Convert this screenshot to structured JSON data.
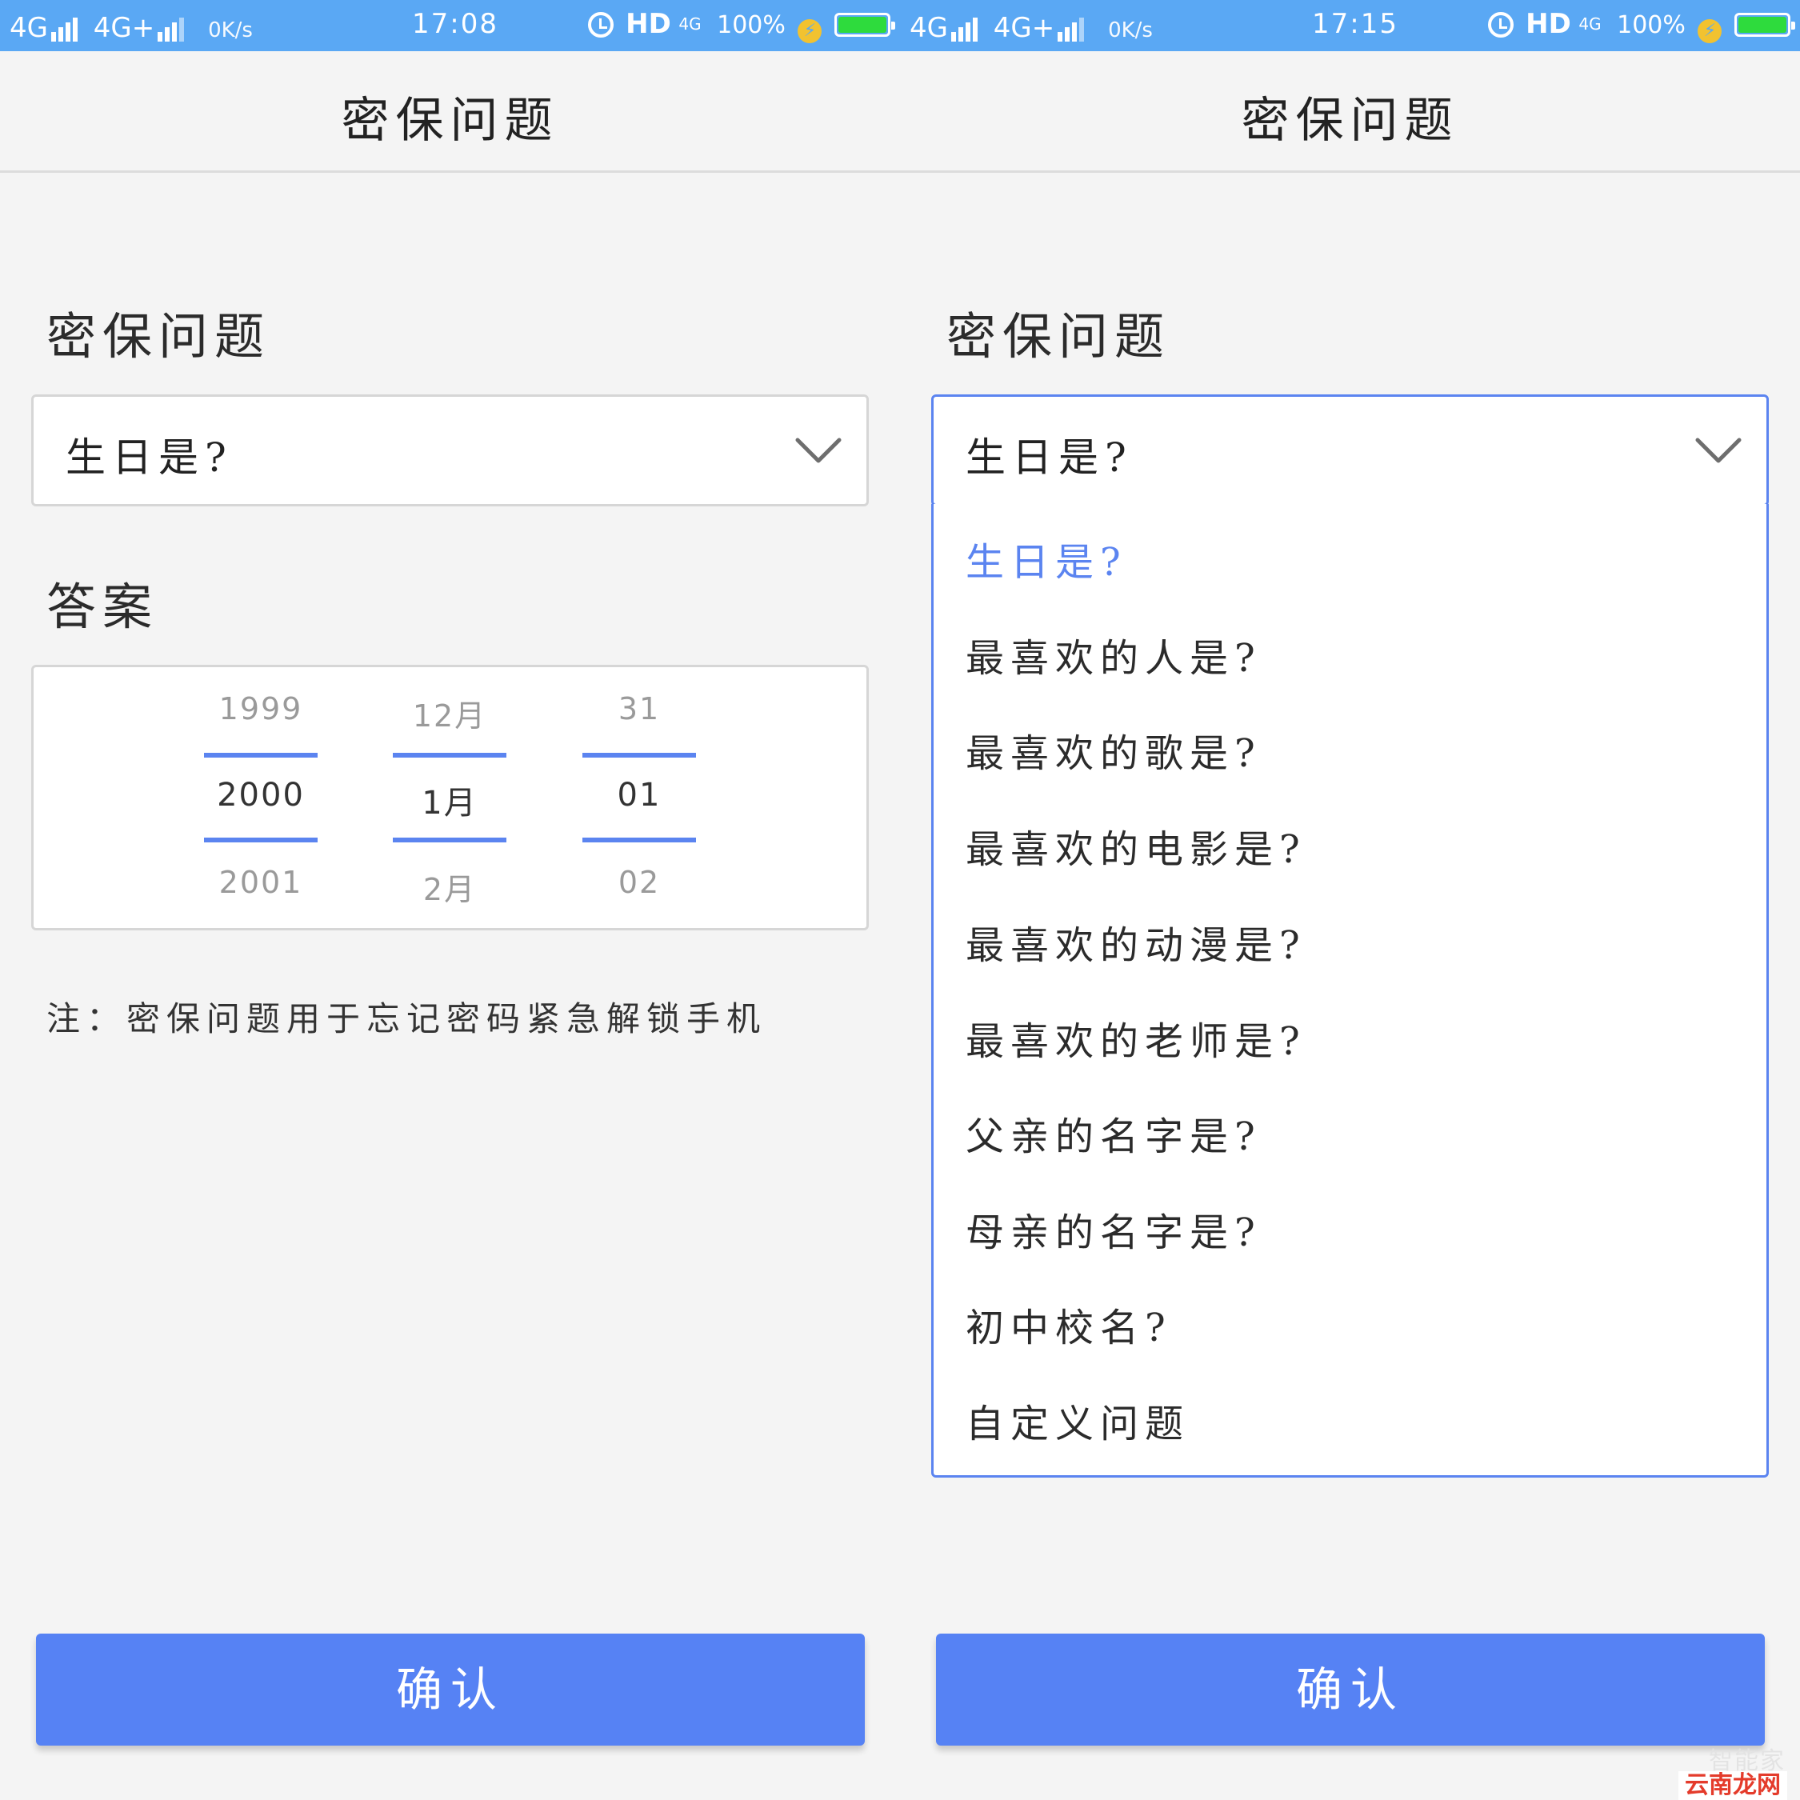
{
  "status_bar": {
    "network_1": "4G",
    "network_2": "4G+",
    "speed": "0K/s",
    "hd_label": "HD",
    "net_type": "4G",
    "battery": "100%"
  },
  "screens": [
    {
      "time": "17:08",
      "title": "密保问题",
      "question_label": "密保问题",
      "selected_question": "生日是?",
      "answer_label": "答案",
      "picker": {
        "year": {
          "prev": "1999",
          "current": "2000",
          "next": "2001"
        },
        "month": {
          "prev": "12月",
          "current": "1月",
          "next": "2月"
        },
        "day": {
          "prev": "31",
          "current": "01",
          "next": "02"
        }
      },
      "note": "注：密保问题用于忘记密码紧急解锁手机",
      "confirm_label": "确认"
    },
    {
      "time": "17:15",
      "title": "密保问题",
      "question_label": "密保问题",
      "selected_question": "生日是?",
      "options": [
        "生日是?",
        "最喜欢的人是?",
        "最喜欢的歌是?",
        "最喜欢的电影是?",
        "最喜欢的动漫是?",
        "最喜欢的老师是?",
        "父亲的名字是?",
        "母亲的名字是?",
        "初中校名?",
        "自定义问题"
      ],
      "confirm_label": "确认"
    }
  ],
  "watermark": {
    "line1": "智能家",
    "line2": "云南龙网"
  },
  "colors": {
    "status_bar": "#5aa8f4",
    "accent": "#5682f4",
    "picker_line": "#5b84f0",
    "background": "#f4f4f4"
  }
}
